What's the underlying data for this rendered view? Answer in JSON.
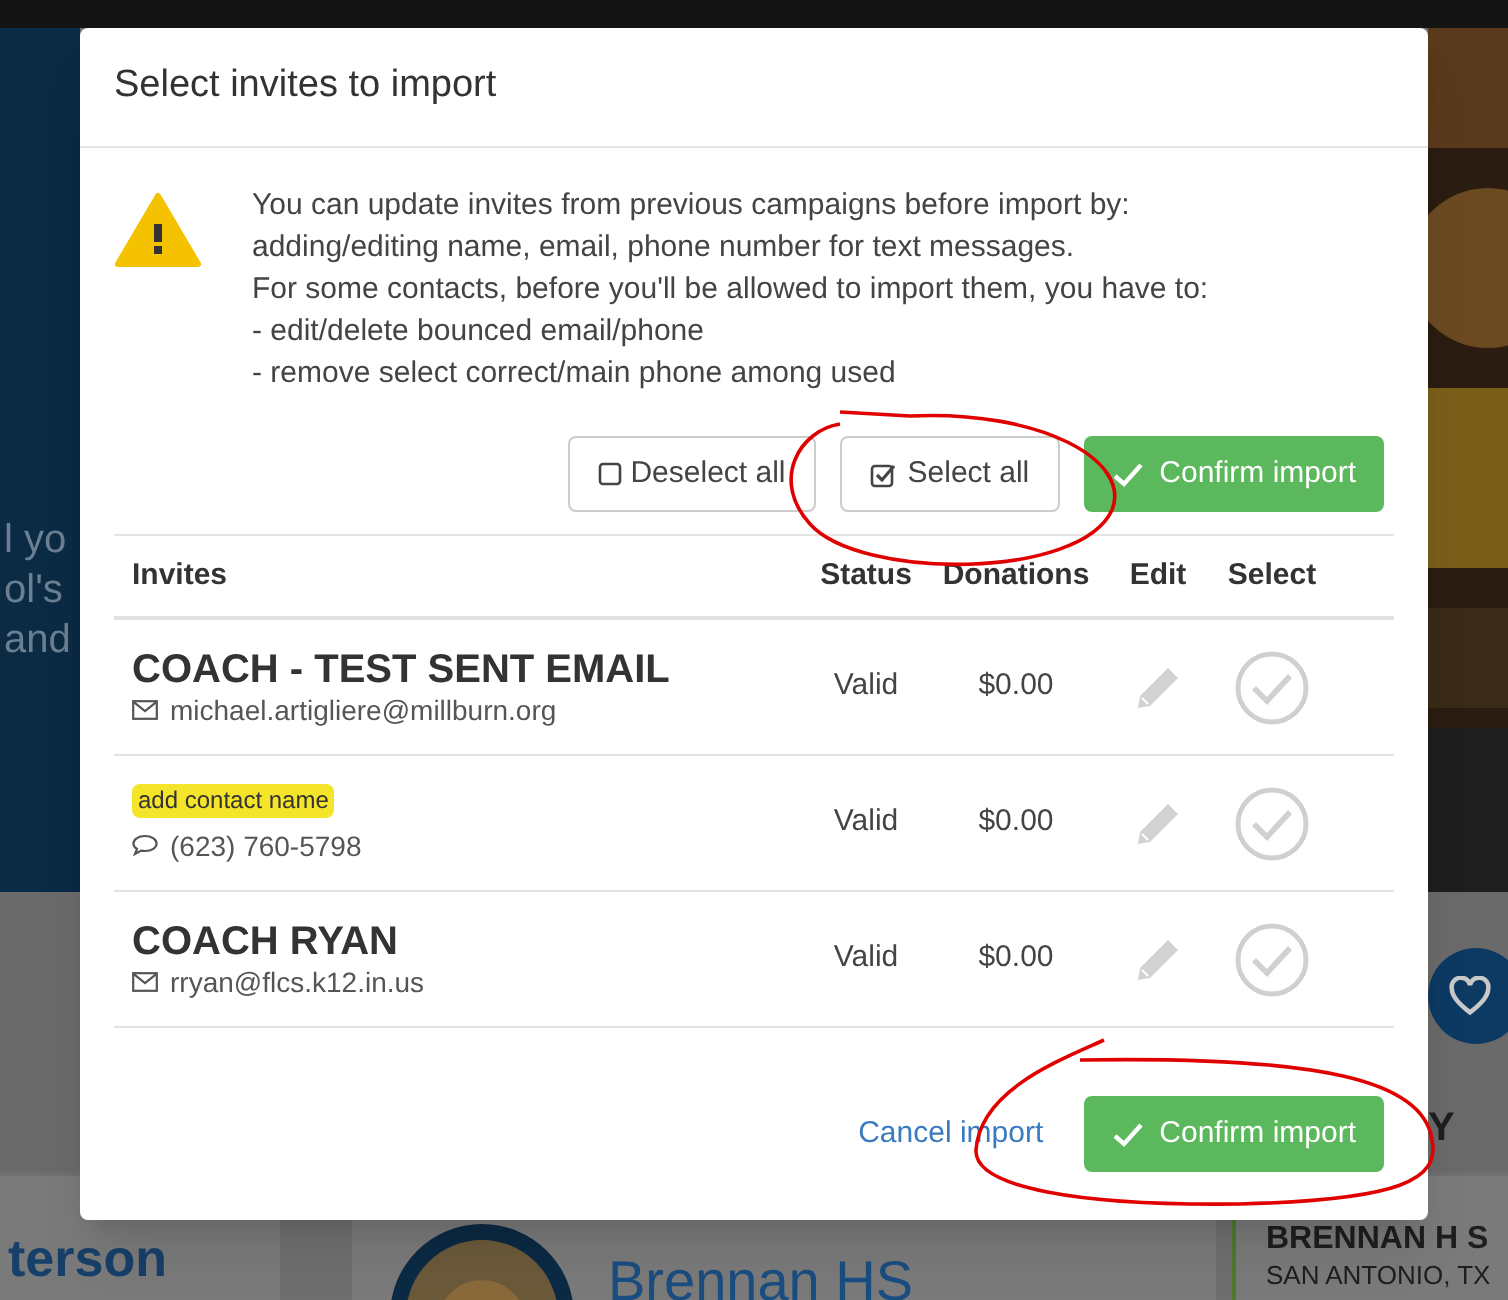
{
  "background": {
    "left_fragments": [
      "l yo",
      "ol's",
      "and"
    ],
    "school_name_cut": "terson",
    "school_title": "Brennan HS",
    "card_title": "BRENNAN H S",
    "card_location": "SAN ANTONIO, TX",
    "edge_letter": "Y"
  },
  "modal": {
    "title": "Select invites to import",
    "notice_lines": [
      "You can update invites from previous campaigns before import by:",
      "adding/editing name, email, phone number for text messages.",
      "For some contacts, before you'll be allowed to import them, you have to:",
      "- edit/delete bounced email/phone",
      "- remove select correct/main phone among used"
    ],
    "actions": [
      {
        "kind": "deselect",
        "label": "Deselect all"
      },
      {
        "kind": "select",
        "label": "Select all"
      },
      {
        "kind": "confirm",
        "label": "Confirm import"
      }
    ],
    "table": {
      "columns": [
        "Invites",
        "Status",
        "Donations",
        "Edit",
        "Select"
      ],
      "rows": [
        {
          "kind": "named",
          "name": "COACH - TEST SENT EMAIL",
          "contact": {
            "kind": "email",
            "text": "michael.artigliere@millburn.org"
          },
          "status": "Valid",
          "donations": "$0.00",
          "selected": false
        },
        {
          "kind": "unnamed",
          "tag": "add contact name",
          "contact": {
            "kind": "phone",
            "text": "(623) 760-5798"
          },
          "status": "Valid",
          "donations": "$0.00",
          "selected": false
        },
        {
          "kind": "named",
          "name": "COACH RYAN",
          "contact": {
            "kind": "email",
            "text": "rryan@flcs.k12.in.us"
          },
          "status": "Valid",
          "donations": "$0.00",
          "selected": false
        }
      ]
    },
    "footer": {
      "cancel": "Cancel import",
      "confirm": "Confirm import"
    }
  }
}
